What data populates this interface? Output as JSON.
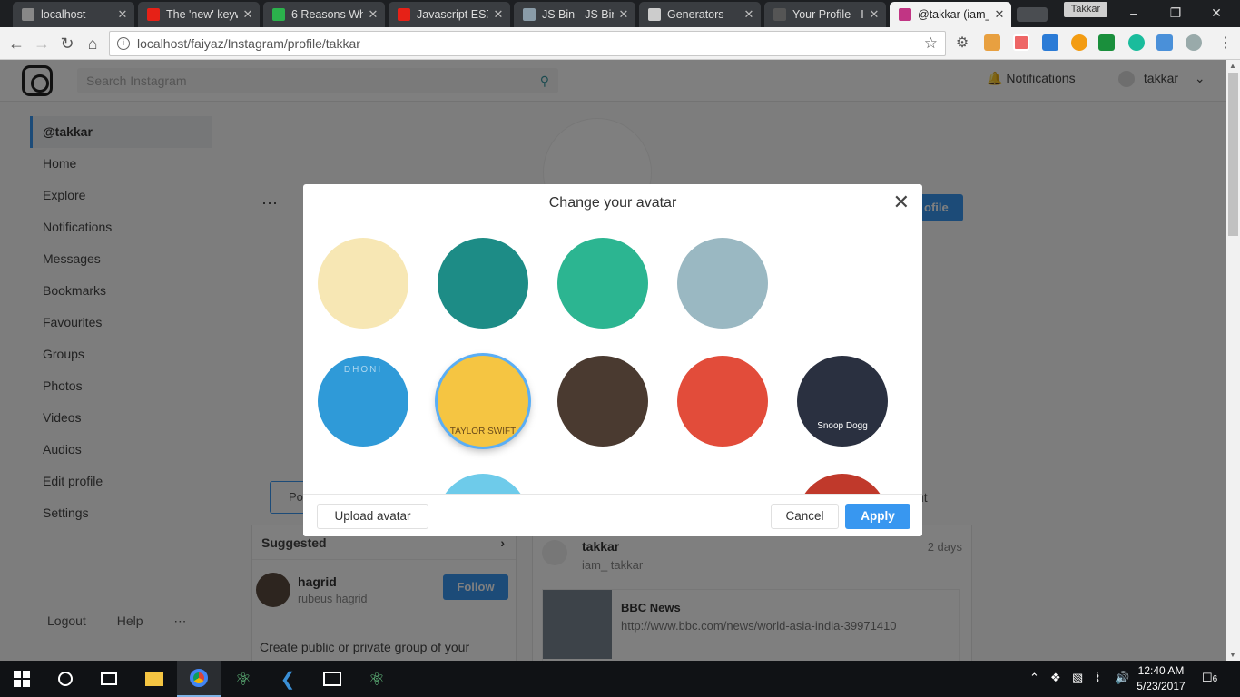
{
  "browser": {
    "tabs": [
      {
        "title": "localhost",
        "icon": "document-icon",
        "color": "#888888"
      },
      {
        "title": "The 'new' keyw",
        "icon": "youtube-icon",
        "color": "#e62117"
      },
      {
        "title": "6 Reasons Wh",
        "icon": "clock-icon",
        "color": "#2bb24c"
      },
      {
        "title": "Javascript ES7",
        "icon": "youtube-icon",
        "color": "#e62117"
      },
      {
        "title": "JS Bin - JS Bin",
        "icon": "jsbin-icon",
        "color": "#8a9ca8"
      },
      {
        "title": "Generators",
        "icon": "codepen-icon",
        "color": "#cccccc"
      },
      {
        "title": "Your Profile - I",
        "icon": "h-icon",
        "color": "#555555"
      },
      {
        "title": "@takkar (iam_",
        "icon": "instagram-icon",
        "color": "#c13584"
      }
    ],
    "profile_chip": "Takkar",
    "url": "localhost/faiyaz/Instagram/profile/takkar"
  },
  "app": {
    "search_placeholder": "Search Instagram",
    "notifications_label": "Notifications",
    "username": "takkar",
    "sidebar": [
      {
        "label": "@takkar",
        "active": true
      },
      {
        "label": "Home"
      },
      {
        "label": "Explore"
      },
      {
        "label": "Notifications"
      },
      {
        "label": "Messages"
      },
      {
        "label": "Bookmarks"
      },
      {
        "label": "Favourites"
      },
      {
        "label": "Groups"
      },
      {
        "label": "Photos"
      },
      {
        "label": "Videos"
      },
      {
        "label": "Audios"
      },
      {
        "label": "Edit profile"
      },
      {
        "label": "Settings"
      }
    ],
    "logout_label": "Logout",
    "help_label": "Help",
    "edit_profile_cut": "ofile",
    "posts_tab_cut": "Po",
    "about_tab_cut": "ut",
    "suggested": {
      "header": "Suggested",
      "user_name": "hagrid",
      "user_sub": "rubeus hagrid",
      "follow_label": "Follow",
      "desc": "Create public or private group of your interest with people you know"
    },
    "post": {
      "user": "takkar",
      "handle": "iam_ takkar",
      "time": "2 days",
      "link_title": "BBC News",
      "link_url": "http://www.bbc.com/news/world-asia-india-39971410"
    }
  },
  "modal": {
    "title": "Change your avatar",
    "upload_label": "Upload avatar",
    "cancel_label": "Cancel",
    "apply_label": "Apply",
    "avatars": [
      {
        "name": "avatar-boy-glasses",
        "bg": "#f7e7b4"
      },
      {
        "name": "avatar-grandma",
        "bg": "#1d8c86"
      },
      {
        "name": "avatar-notebook",
        "bg": "#2cb591"
      },
      {
        "name": "avatar-anonymous",
        "bg": "#9ab8c2"
      },
      {
        "name": "avatar-superman",
        "bg": "#ffffff"
      },
      {
        "name": "avatar-cricketer",
        "bg": "#2f9ad8",
        "text": "DHONI"
      },
      {
        "name": "avatar-taylor-swift",
        "bg": "#f5c542",
        "selected": true,
        "text": "TAYLOR SWIFT"
      },
      {
        "name": "avatar-boxer",
        "bg": "#4a3a30"
      },
      {
        "name": "avatar-pulp-fiction",
        "bg": "#e24c3a"
      },
      {
        "name": "avatar-snoop-dogg",
        "bg": "#2a3040",
        "text": "Snoop Dogg"
      },
      {
        "name": "avatar-row3-1",
        "bg": "#ffffff"
      },
      {
        "name": "avatar-row3-2",
        "bg": "#6ecbea"
      },
      {
        "name": "avatar-row3-3",
        "bg": "#ffffff"
      },
      {
        "name": "avatar-row3-4",
        "bg": "#ffffff"
      },
      {
        "name": "avatar-row3-5",
        "bg": "#c0392b"
      }
    ]
  },
  "taskbar": {
    "time": "12:40 AM",
    "date": "5/23/2017",
    "notif_count": "6"
  }
}
